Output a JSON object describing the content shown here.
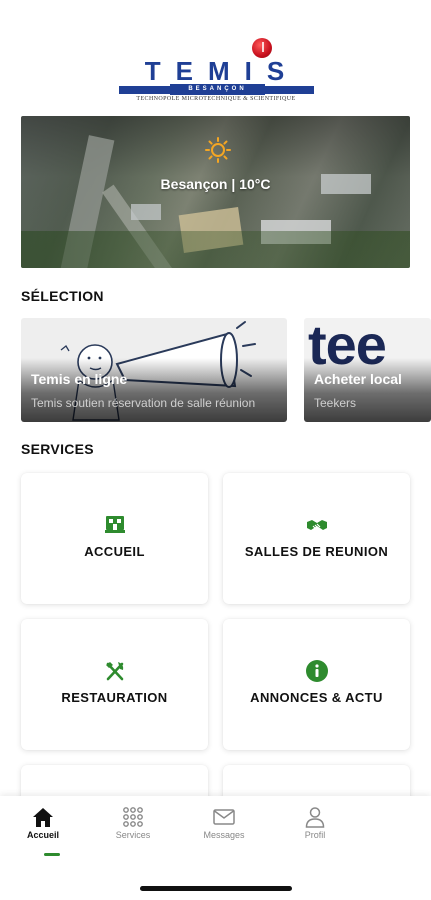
{
  "header": {
    "logo_word": "TEMIS",
    "logo_city": "BESANÇON",
    "logo_tagline": "TECHNOPOLE MICROTECHNIQUE & SCIENTIFIQUE"
  },
  "weather": {
    "text": "Besançon | 10°C",
    "icon": "sun-icon"
  },
  "selection": {
    "title": "SÉLECTION",
    "cards": [
      {
        "title": "Temis en ligne",
        "subtitle": "Temis soutien réservation de salle réunion"
      },
      {
        "title": "Acheter local",
        "subtitle": "Teekers",
        "image_text": "tee"
      }
    ]
  },
  "services": {
    "title": "SERVICES",
    "items": [
      {
        "label": "ACCUEIL",
        "icon": "reception-desk-icon"
      },
      {
        "label": "SALLES DE REUNION",
        "icon": "handshake-icon"
      },
      {
        "label": "RESTAURATION",
        "icon": "fork-knife-icon"
      },
      {
        "label": "ANNONCES & ACTU",
        "icon": "info-icon"
      }
    ]
  },
  "tabbar": {
    "tabs": [
      {
        "label": "Accueil",
        "icon": "home-icon",
        "active": true
      },
      {
        "label": "Services",
        "icon": "grid-icon",
        "active": false
      },
      {
        "label": "Messages",
        "icon": "envelope-icon",
        "active": false
      },
      {
        "label": "Profil",
        "icon": "user-icon",
        "active": false
      }
    ]
  },
  "colors": {
    "brand_blue": "#1f3f95",
    "brand_red": "#c8101e",
    "accent_green": "#2e8b2e"
  }
}
